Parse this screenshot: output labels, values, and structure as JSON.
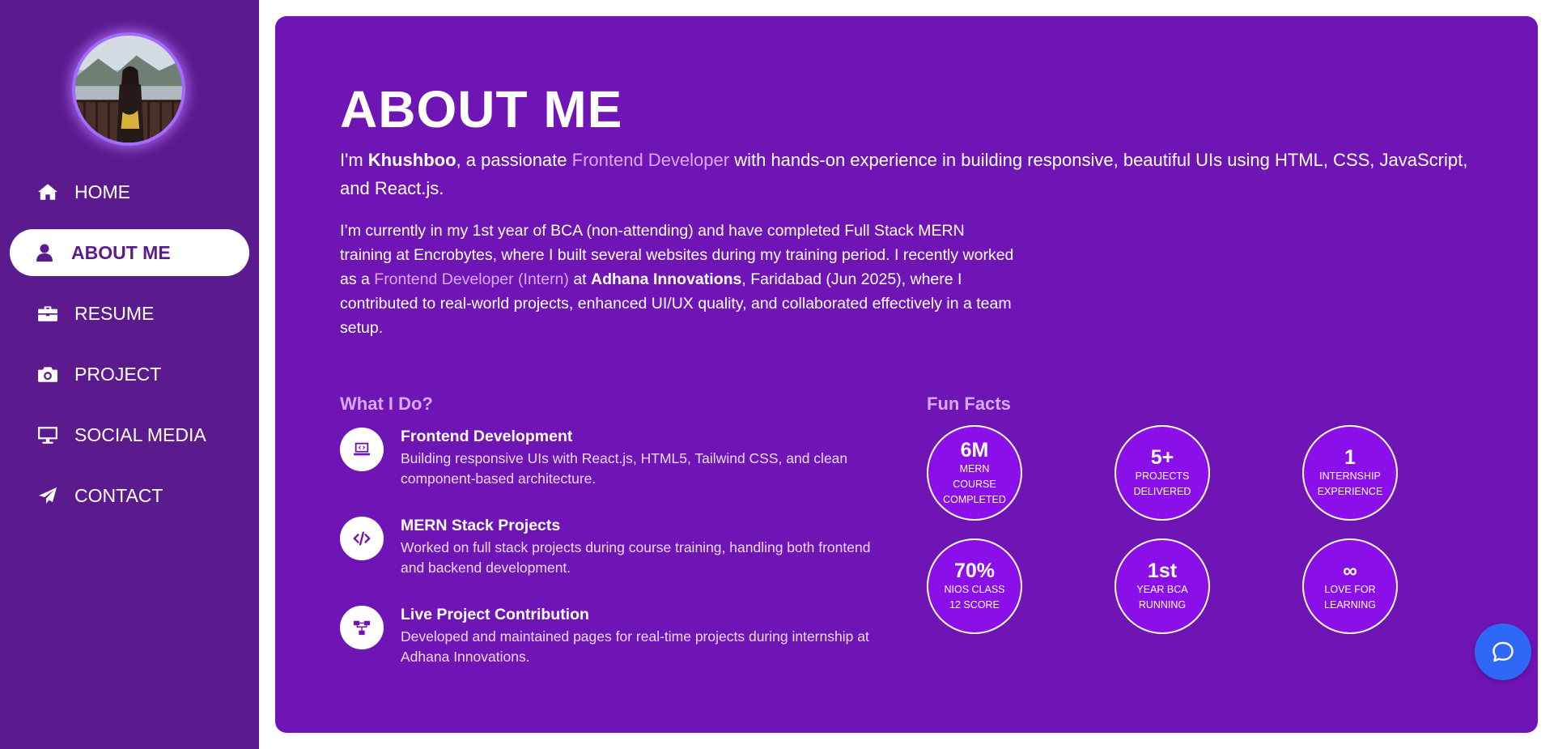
{
  "sidebar": {
    "nav": [
      {
        "label": "HOME",
        "icon": "home-icon"
      },
      {
        "label": "ABOUT ME",
        "icon": "user-icon",
        "active": true
      },
      {
        "label": "RESUME",
        "icon": "briefcase-icon"
      },
      {
        "label": "PROJECT",
        "icon": "camera-icon"
      },
      {
        "label": "SOCIAL MEDIA",
        "icon": "monitor-icon"
      },
      {
        "label": "CONTACT",
        "icon": "paper-plane-icon"
      }
    ]
  },
  "about": {
    "title": "ABOUT ME",
    "intro": {
      "p1": "I'm ",
      "name": "Khushboo",
      "p2": ", a passionate ",
      "role": "Frontend Developer",
      "p3": " with hands-on experience in building responsive, beautiful UIs using HTML, CSS, JavaScript, and React.js."
    },
    "para": {
      "p1": "I’m currently in my 1st year of BCA (non-attending) and have completed Full Stack MERN training at Encrobytes, where I built several websites during my training period. I recently worked as a ",
      "role": "Frontend Developer (Intern)",
      "p2": " at ",
      "company": "Adhana Innovations",
      "p3": ", Faridabad (Jun 2025), where I contributed to real-world projects, enhanced UI/UX quality, and collaborated effectively in a team setup."
    },
    "what_heading": "What I Do?",
    "skills": [
      {
        "title": "Frontend Development",
        "desc": "Building responsive UIs with React.js, HTML5, Tailwind CSS, and clean component-based architecture.",
        "icon": "laptop-code-icon"
      },
      {
        "title": "MERN Stack Projects",
        "desc": "Worked on full stack projects during course training, handling both frontend and backend development.",
        "icon": "code-icon"
      },
      {
        "title": "Live Project Contribution",
        "desc": "Developed and maintained pages for real-time projects during internship at Adhana Innovations.",
        "icon": "sitemap-icon"
      }
    ],
    "fun_heading": "Fun Facts",
    "facts": [
      {
        "num": "6M",
        "label": "MERN COURSE COMPLETED"
      },
      {
        "num": "5+",
        "label": "PROJECTS DELIVERED"
      },
      {
        "num": "1",
        "label": "INTERNSHIP EXPERIENCE"
      },
      {
        "num": "70%",
        "label": "NIOS CLASS 12 SCORE"
      },
      {
        "num": "1st",
        "label": "YEAR BCA RUNNING"
      },
      {
        "num": "∞",
        "label": "LOVE FOR LEARNING"
      }
    ]
  },
  "colors": {
    "sidebar_bg": "#5c1a8f",
    "main_bg": "#6f15b5",
    "accent": "#d9a8ff",
    "fact_bg": "#8a0fe8",
    "chat_button": "#2f67f6"
  },
  "chat": {
    "icon": "chat-bubble-icon"
  }
}
